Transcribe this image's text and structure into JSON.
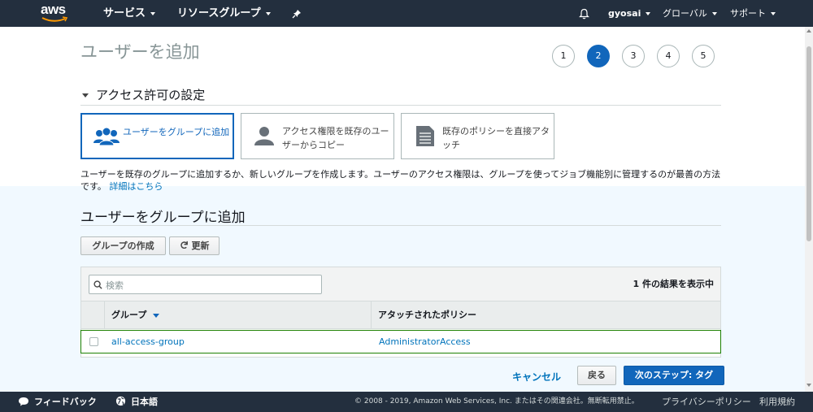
{
  "topnav": {
    "logo": "aws",
    "services": "サービス",
    "resource_groups": "リソースグループ",
    "pin_icon": "pin-icon",
    "bell_icon": "bell-icon",
    "user": "gyosai",
    "region": "グローバル",
    "support": "サポート"
  },
  "page": {
    "title": "ユーザーを追加",
    "steps": [
      "1",
      "2",
      "3",
      "4",
      "5"
    ],
    "active_step": "2"
  },
  "permissions": {
    "section_title": "アクセス許可の設定",
    "options": [
      {
        "label": "ユーザーをグループに追加",
        "icon": "users-group-icon"
      },
      {
        "label": "アクセス権限を既存のユーザーからコピー",
        "icon": "user-icon"
      },
      {
        "label": "既存のポリシーを直接アタッチ",
        "icon": "document-icon"
      }
    ],
    "description": "ユーザーを既存のグループに追加するか、新しいグループを作成します。ユーザーのアクセス権限は、グループを使ってジョブ機能別に管理するのが最善の方法です。",
    "learn_more": "詳細はこちら"
  },
  "group_section": {
    "title": "ユーザーをグループに追加",
    "create_group": "グループの作成",
    "refresh": "更新"
  },
  "table": {
    "search_placeholder": "検索",
    "result_count": "1 件の結果を表示中",
    "columns": [
      "グループ",
      "アタッチされたポリシー"
    ],
    "rows": [
      {
        "group": "all-access-group",
        "policy": "AdministratorAccess",
        "selected": false
      }
    ]
  },
  "actions": {
    "cancel": "キャンセル",
    "back": "戻る",
    "next": "次のステップ: タグ"
  },
  "bottombar": {
    "feedback": "フィードバック",
    "language": "日本語",
    "copyright": "© 2008 - 2019, Amazon Web Services, Inc. またはその関連会社。無断転用禁止。",
    "privacy": "プライバシーポリシー",
    "terms": "利用規約"
  },
  "colors": {
    "nav_bg": "#232f3e",
    "accent": "#1166bb",
    "link": "#0073bb",
    "primary_button": "#1166bb",
    "selected_row_border": "#1d8102"
  }
}
